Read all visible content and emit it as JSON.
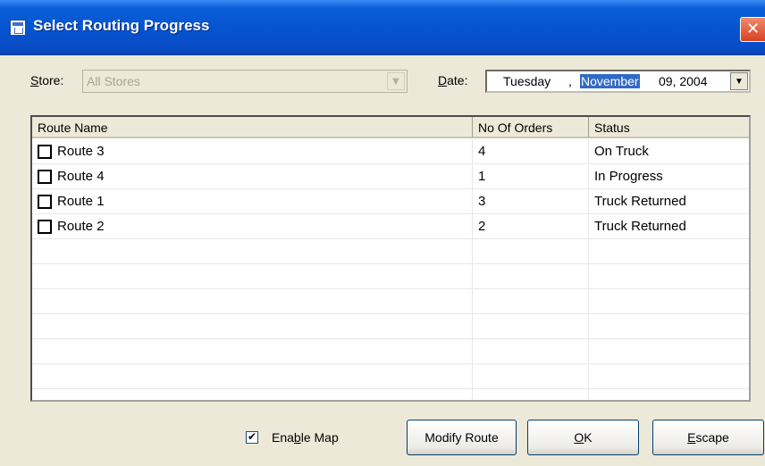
{
  "window": {
    "title": "Select Routing Progress",
    "close_glyph": "✕"
  },
  "filters": {
    "store_label": "Store:",
    "store_value": "All Stores",
    "date_label": "Date:",
    "date_weekday": "Tuesday",
    "date_sep": ",",
    "date_month": "November",
    "date_rest": "09, 2004"
  },
  "table": {
    "columns": [
      "Route Name",
      "No Of Orders",
      "Status"
    ],
    "rows": [
      {
        "name": "Route 3",
        "orders": "4",
        "status": "On Truck"
      },
      {
        "name": "Route 4",
        "orders": "1",
        "status": "In Progress"
      },
      {
        "name": "Route 1",
        "orders": "3",
        "status": "Truck Returned"
      },
      {
        "name": "Route 2",
        "orders": "2",
        "status": "Truck Returned"
      }
    ]
  },
  "footer": {
    "enable_map_label": "Enable Map",
    "enable_map_checked": true,
    "modify_route_label": "Modify Route",
    "ok_label": "OK",
    "escape_label": "Escape"
  },
  "icons": {
    "title": "form-icon",
    "close": "close-icon",
    "dropdown": "chevron-down-icon",
    "checkbox": "checkbox-icon"
  },
  "colors": {
    "titlebar": "#0553d0",
    "selection": "#316ac5",
    "close": "#d9421f",
    "face": "#ece9d8"
  }
}
